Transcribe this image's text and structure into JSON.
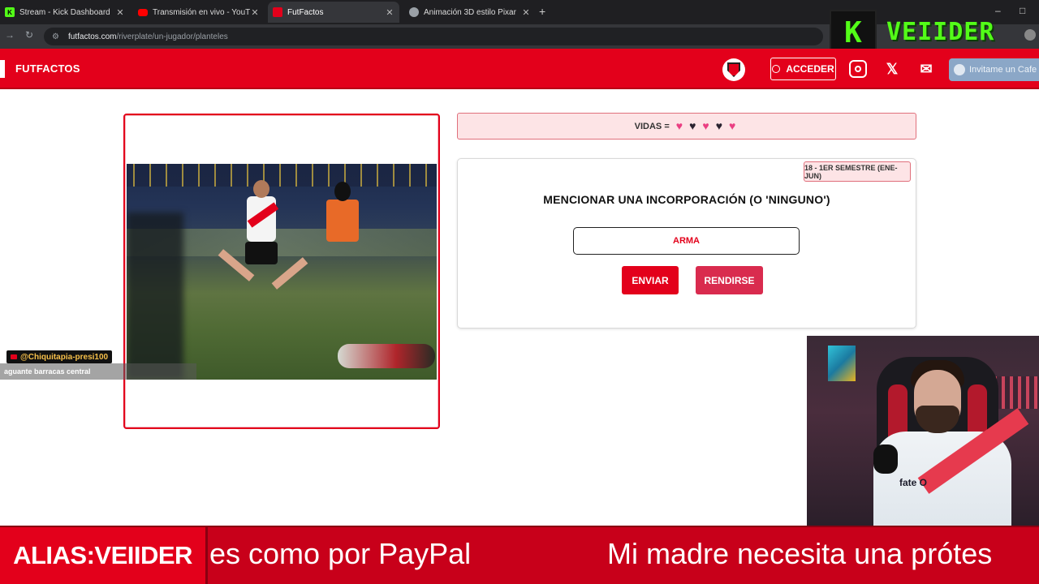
{
  "browser": {
    "tabs": [
      {
        "title": "Stream - Kick Dashboard",
        "fav": "K",
        "fav_color": "#53fc18"
      },
      {
        "title": "Transmisión en vivo - YouTube",
        "fav": "",
        "fav_color": "#ff0000"
      },
      {
        "title": "FutFactos",
        "fav": "",
        "fav_color": "#e3001b"
      },
      {
        "title": "Animación 3D estilo Pixar",
        "fav": "",
        "fav_color": "#9aa0a6"
      }
    ],
    "url_host": "futfactos.com",
    "url_path": "/riverplate/un-jugador/planteles"
  },
  "overlay": {
    "streamer_name": "VEIIDER",
    "kick_letter": "K"
  },
  "site": {
    "brand": "FUTFACTOS",
    "login_label": "ACCEDER",
    "coffee_label": "Invitame un Cafe",
    "x_label": "𝕏",
    "mail_label": "✉"
  },
  "game": {
    "lives_label": "VIDAS =",
    "lives": [
      true,
      false,
      true,
      false,
      true
    ],
    "period": "18 - 1ER SEMESTRE (ENE-JUN)",
    "question": "MENCIONAR UNA INCORPORACIÓN (O 'NINGUNO')",
    "answer_value": "ARMA",
    "send_label": "ENVIAR",
    "giveup_label": "RENDIRSE"
  },
  "chat": {
    "user": "@Chiquitapia-presi100",
    "message": "aguante barracas central"
  },
  "webcam": {
    "sponsor": "fate O"
  },
  "ticker": {
    "alias": "ALIAS:VEIIDER",
    "text_1": "es como por PayPal",
    "text_2": "Mi madre necesita una prótes"
  },
  "colors": {
    "brand_red": "#e3001b",
    "kick_green": "#53fc18",
    "heart_pink": "#ea3f82"
  }
}
